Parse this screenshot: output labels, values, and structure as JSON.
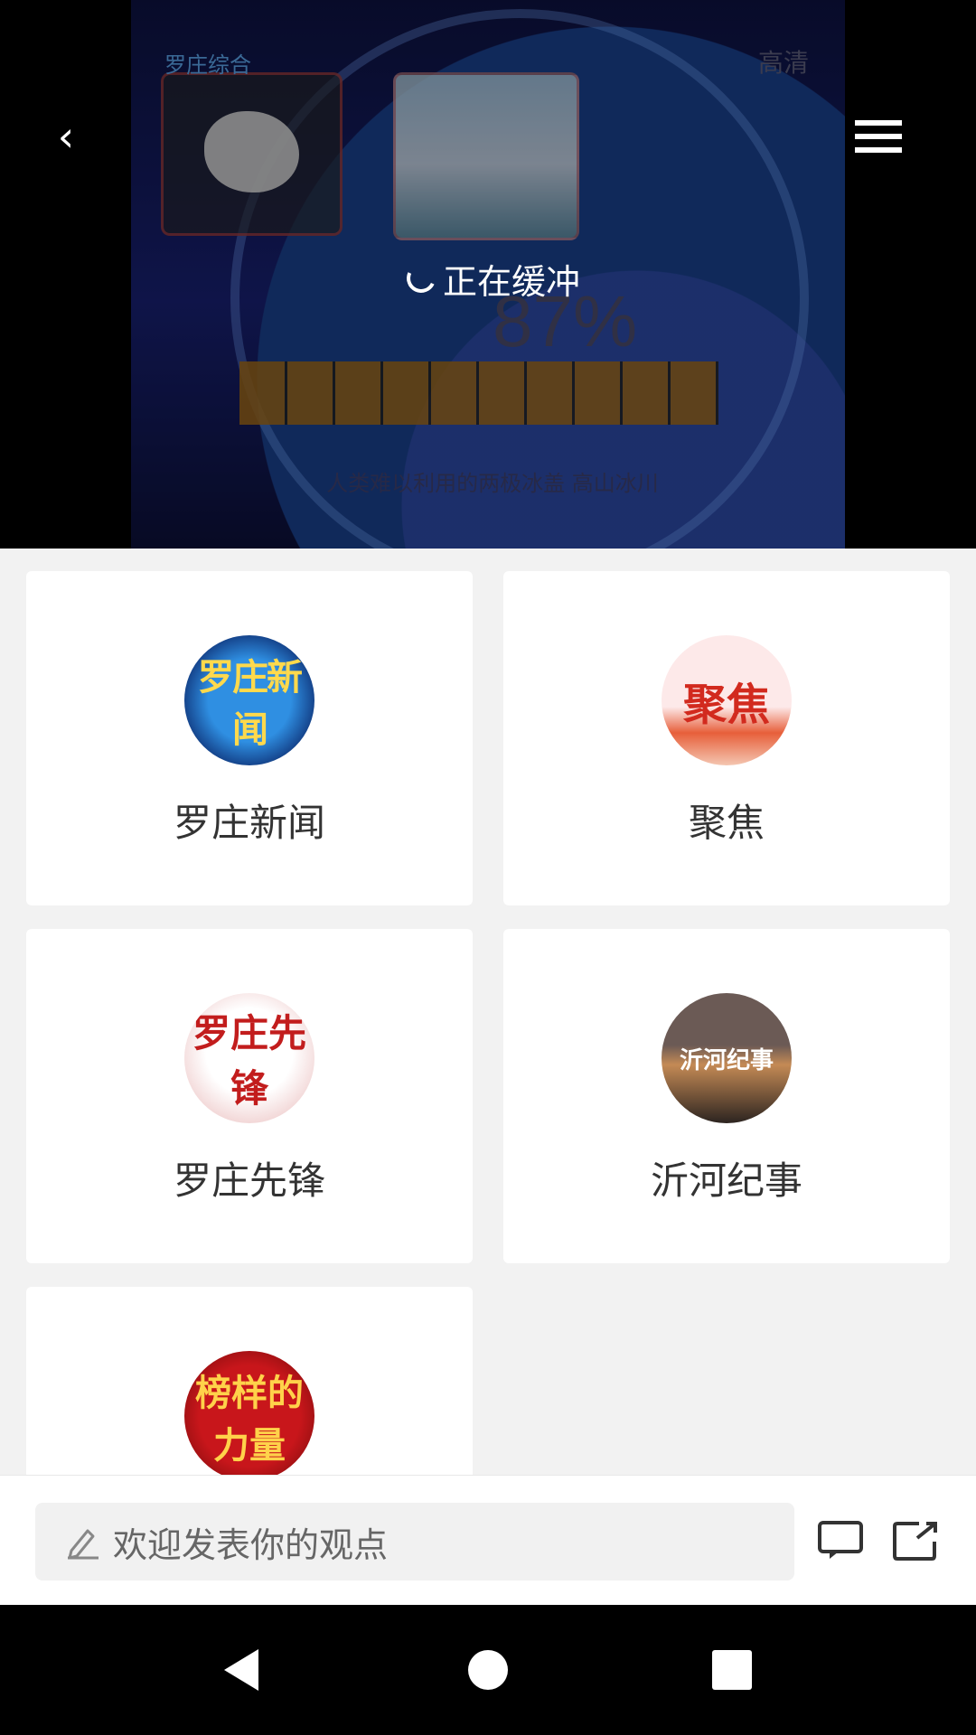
{
  "player": {
    "buffering_text": "正在缓冲",
    "channel_watermark": "罗庄综合",
    "quality_label": "高清",
    "video_caption": "人类难以利用的两极冰盖 高山冰川",
    "video_percent": "87%",
    "icons": [
      "back-icon",
      "menu-icon",
      "spinner-icon"
    ]
  },
  "programs": [
    {
      "title": "罗庄新闻",
      "thumb_text": "罗庄新闻"
    },
    {
      "title": "聚焦",
      "thumb_text": "聚焦"
    },
    {
      "title": "罗庄先锋",
      "thumb_text": "罗庄先锋"
    },
    {
      "title": "沂河纪事",
      "thumb_text": "沂河纪事"
    },
    {
      "title": "",
      "thumb_text": "榜样的力量"
    }
  ],
  "comment_bar": {
    "placeholder": "欢迎发表你的观点",
    "icons": [
      "edit-icon",
      "comment-icon",
      "share-icon"
    ]
  },
  "nav_bar": {
    "icons": [
      "nav-back-icon",
      "nav-home-icon",
      "nav-recent-icon"
    ]
  }
}
